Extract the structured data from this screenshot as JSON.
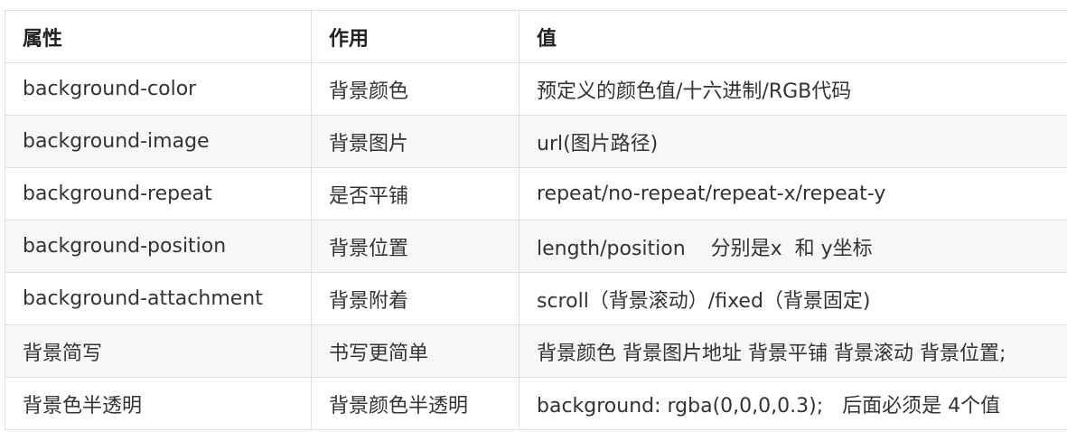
{
  "table": {
    "headers": [
      "属性",
      "作用",
      "值"
    ],
    "rows": [
      [
        "background-color",
        "背景颜色",
        "预定义的颜色值/十六进制/RGB代码"
      ],
      [
        "background-image",
        "背景图片",
        "url(图片路径)"
      ],
      [
        "background-repeat",
        "是否平铺",
        "repeat/no-repeat/repeat-x/repeat-y"
      ],
      [
        "background-position",
        "背景位置",
        "length/position    分别是x  和 y坐标"
      ],
      [
        "background-attachment",
        "背景附着",
        "scroll（背景滚动）/fixed（背景固定)"
      ],
      [
        "背景简写",
        "书写更简单",
        "背景颜色 背景图片地址 背景平铺 背景滚动 背景位置;"
      ],
      [
        "背景色半透明",
        "背景颜色半透明",
        "background: rgba(0,0,0,0.3);   后面必须是 4个值"
      ]
    ]
  }
}
